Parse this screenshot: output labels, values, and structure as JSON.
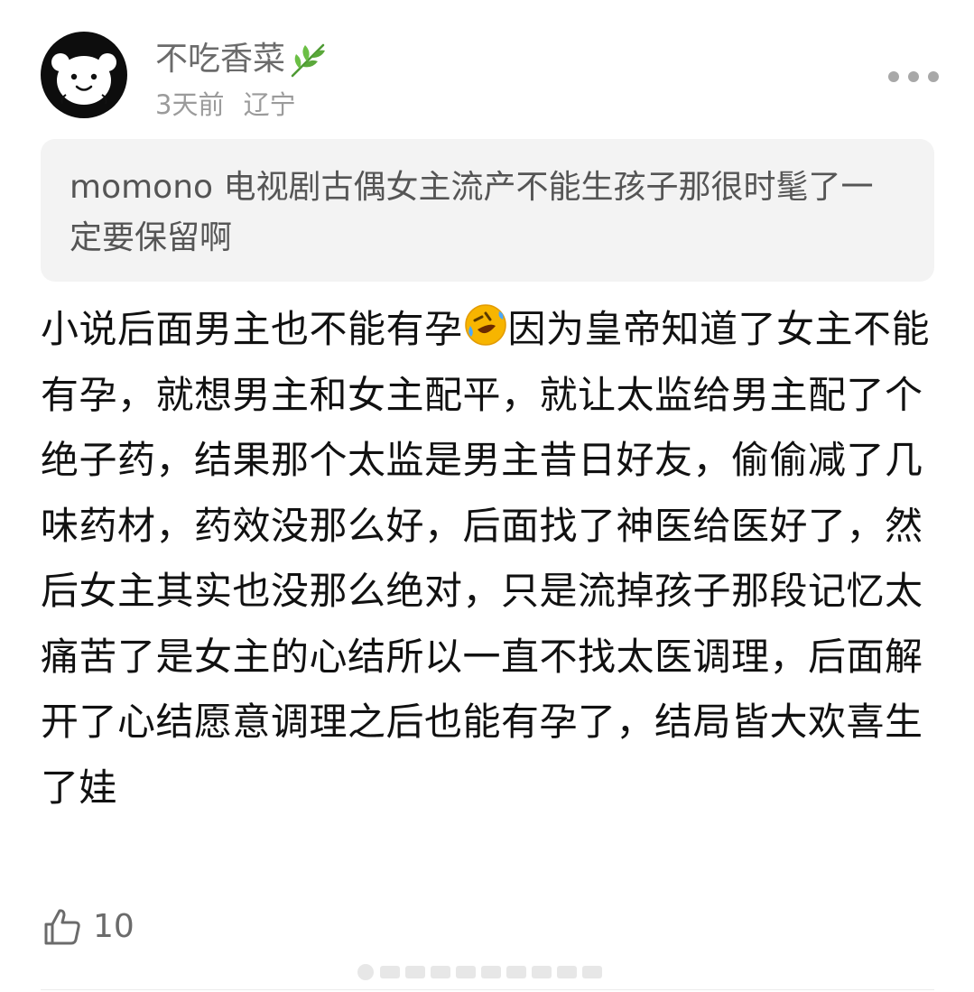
{
  "comment": {
    "author": {
      "name": "不吃香菜",
      "avatar_icon": "cartoon-bear-avatar-icon",
      "badge_icon": "leaf-sprig-icon"
    },
    "time": "3天前",
    "location": "辽宁",
    "more_icon": "more-dots-icon",
    "quoted": {
      "author": "momono",
      "text": "电视剧古偶女主流产不能生孩子那很时髦了一定要保留啊"
    },
    "body": {
      "before_emoji": "小说后面男主也不能有孕",
      "emoji_icon": "rolling-on-floor-laughing-emoji",
      "after_emoji": "因为皇帝知道了女主不能有孕，就想男主和女主配平，就让太监给男主配了个绝子药，结果那个太监是男主昔日好友，偷偷减了几味药材，药效没那么好，后面找了神医给医好了，然后女主其实也没那么绝对，只是流掉孩子那段记忆太痛苦了是女主的心结所以一直不找太医调理，后面解开了心结愿意调理之后也能有孕了，结局皆大欢喜生了娃"
    },
    "likes": {
      "icon": "thumbs-up-icon",
      "count": "10"
    }
  },
  "colors": {
    "username": "#6b6b6b",
    "meta": "#9b9b9b",
    "quote_bg": "#f3f3f3",
    "quote_text": "#555555",
    "body_text": "#111111",
    "leaf": "#5aa83a",
    "emoji": "#f7b500"
  }
}
